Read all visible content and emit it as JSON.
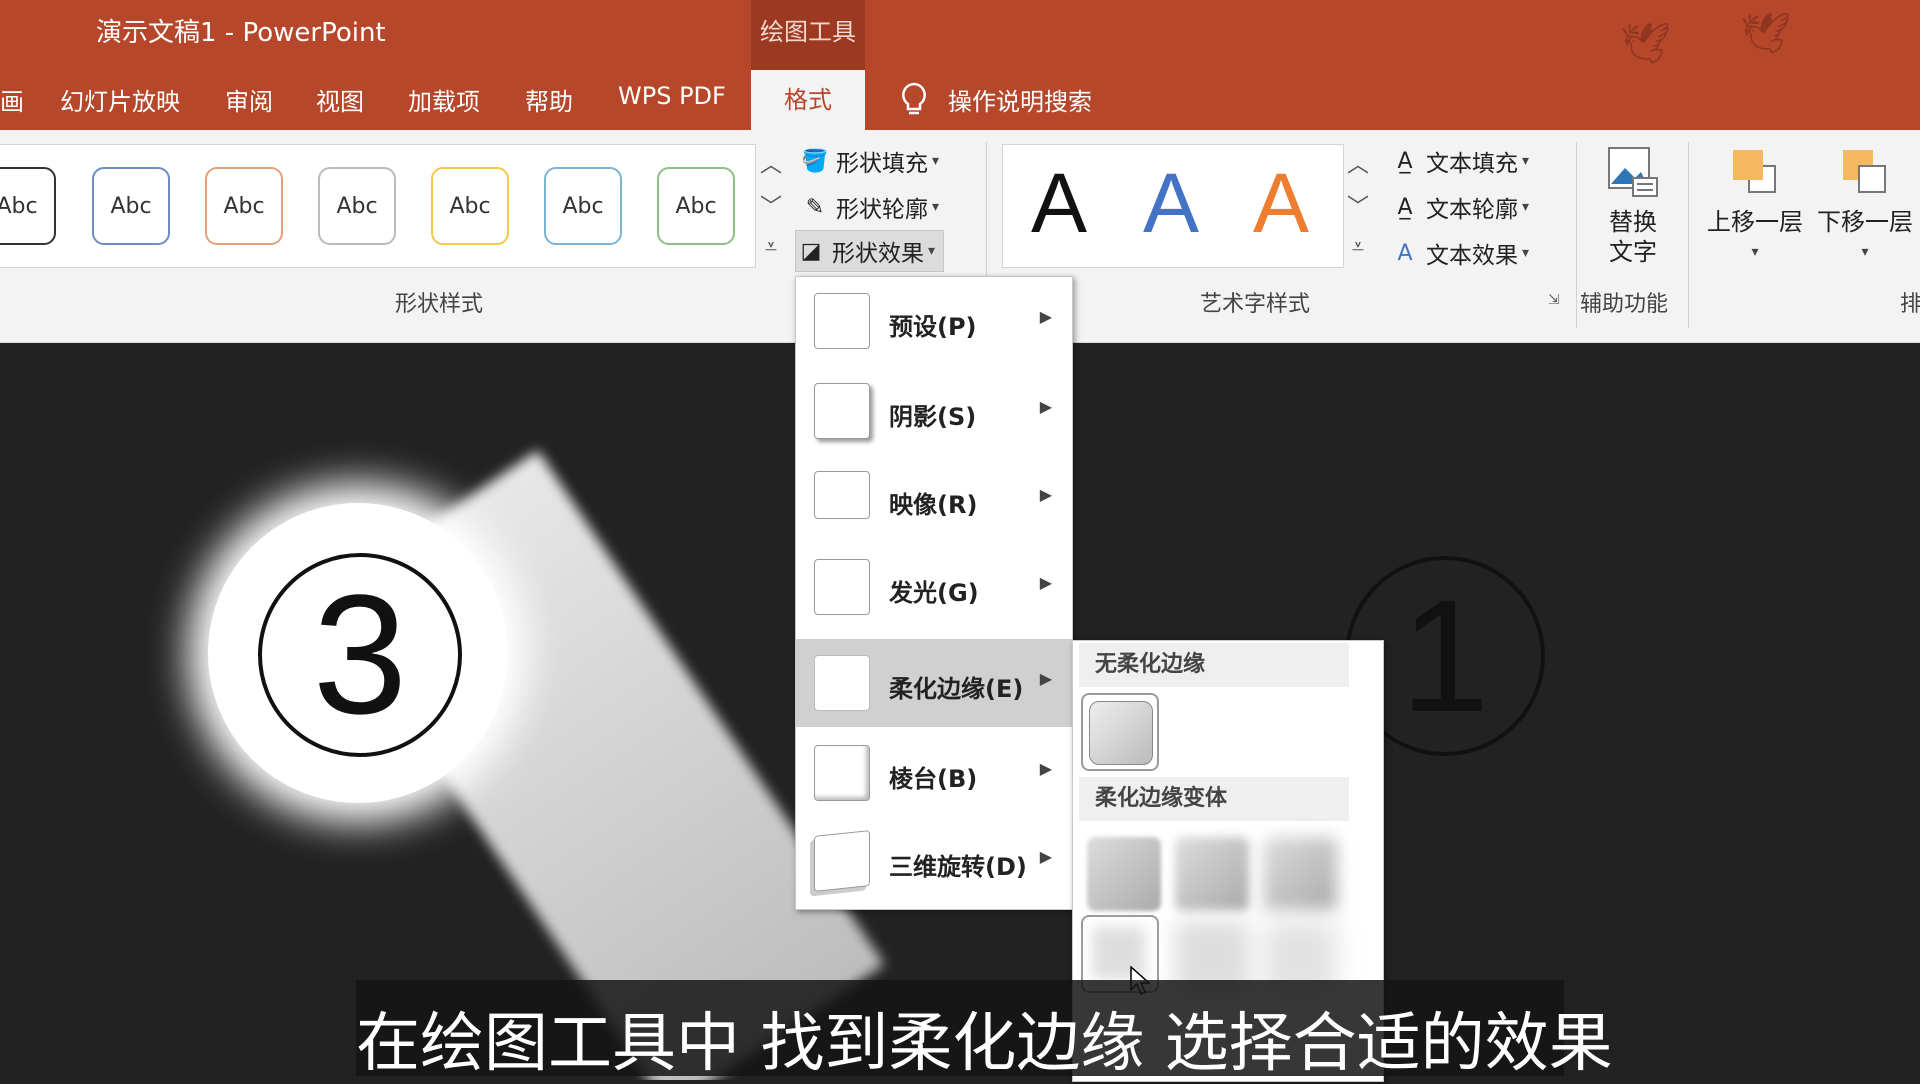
{
  "window": {
    "title": "演示文稿1  -  PowerPoint",
    "context_group": "绘图工具"
  },
  "tabs": [
    {
      "label": "画"
    },
    {
      "label": "幻灯片放映"
    },
    {
      "label": "审阅"
    },
    {
      "label": "视图"
    },
    {
      "label": "加载项"
    },
    {
      "label": "帮助"
    },
    {
      "label": "WPS PDF"
    },
    {
      "label": "格式",
      "active": true
    }
  ],
  "search": {
    "label": "操作说明搜索"
  },
  "shape_styles": {
    "group_label": "形状样式",
    "swatches": [
      {
        "label": "Abc",
        "color": "#333333"
      },
      {
        "label": "Abc",
        "color": "#6c8ebf"
      },
      {
        "label": "Abc",
        "color": "#e39f7e"
      },
      {
        "label": "Abc",
        "color": "#bbbbbb"
      },
      {
        "label": "Abc",
        "color": "#f2c94c"
      },
      {
        "label": "Abc",
        "color": "#7fb3d5"
      },
      {
        "label": "Abc",
        "color": "#8cc084"
      }
    ],
    "fill_label": "形状填充",
    "outline_label": "形状轮廓",
    "effect_label": "形状效果"
  },
  "wordart": {
    "group_label": "艺术字样式",
    "samples": [
      "A",
      "A",
      "A"
    ],
    "text_fill_label": "文本填充",
    "text_outline_label": "文本轮廓",
    "text_effect_label": "文本效果"
  },
  "accessibility": {
    "group_label": "辅助功能",
    "alt_text_label_1": "替换",
    "alt_text_label_2": "文字"
  },
  "arrange": {
    "bring_forward_label": "上移一层",
    "send_backward_label": "下移一层",
    "group_label_partial": "排"
  },
  "effects_menu": {
    "items": [
      {
        "label": "预设(P)"
      },
      {
        "label": "阴影(S)"
      },
      {
        "label": "映像(R)"
      },
      {
        "label": "发光(G)"
      },
      {
        "label": "柔化边缘(E)",
        "highlighted": true
      },
      {
        "label": "棱台(B)"
      },
      {
        "label": "三维旋转(D)"
      }
    ]
  },
  "soft_edges_submenu": {
    "no_soft_edges_heading": "无柔化边缘",
    "variations_heading": "柔化边缘变体"
  },
  "slide": {
    "circle_left_number": "3",
    "circle_right_number": "1"
  },
  "caption": {
    "text": "在绘图工具中 找到柔化边缘  选择合适的效果"
  },
  "colors": {
    "accent": "#b7472a",
    "ribbon_bg": "#f3f3f3",
    "slide_bg": "#222222"
  }
}
